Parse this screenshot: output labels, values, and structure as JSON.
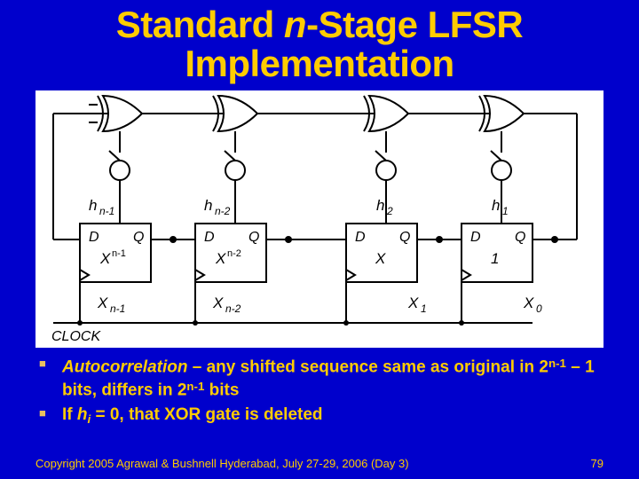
{
  "title": {
    "line1_pre": "Standard ",
    "line1_ital": "n",
    "line1_post": "-Stage LFSR",
    "line2": "Implementation"
  },
  "diagram": {
    "taps": [
      "h",
      "h",
      "h",
      "h"
    ],
    "tap_subs": [
      "n-1",
      "n-2",
      "2",
      "1"
    ],
    "ff": {
      "D": "D",
      "Q": "Q"
    },
    "stage_x": [
      "X",
      "X",
      "X",
      "1"
    ],
    "stage_x_sup": [
      "n-1",
      "n-2",
      "",
      ""
    ],
    "outs": [
      "X",
      "X",
      "X",
      "X"
    ],
    "out_subs": [
      "n-1",
      "n-2",
      "1",
      "0"
    ],
    "clock": "CLOCK"
  },
  "bullets": {
    "b1_a": "Autocorrelation",
    "b1_b": " – any shifted sequence same as original in 2",
    "b1_c": " – 1 bits, differs in 2",
    "b1_d": " bits",
    "exp": "n-1",
    "b2_a": "If ",
    "b2_h": "h",
    "b2_i": "i",
    "b2_b": " = 0, that XOR gate is deleted"
  },
  "footer": {
    "copy": "Copyright 2005 Agrawal & Bushnell   Hyderabad, July 27-29, 2006 (Day 3)",
    "page": "79"
  }
}
